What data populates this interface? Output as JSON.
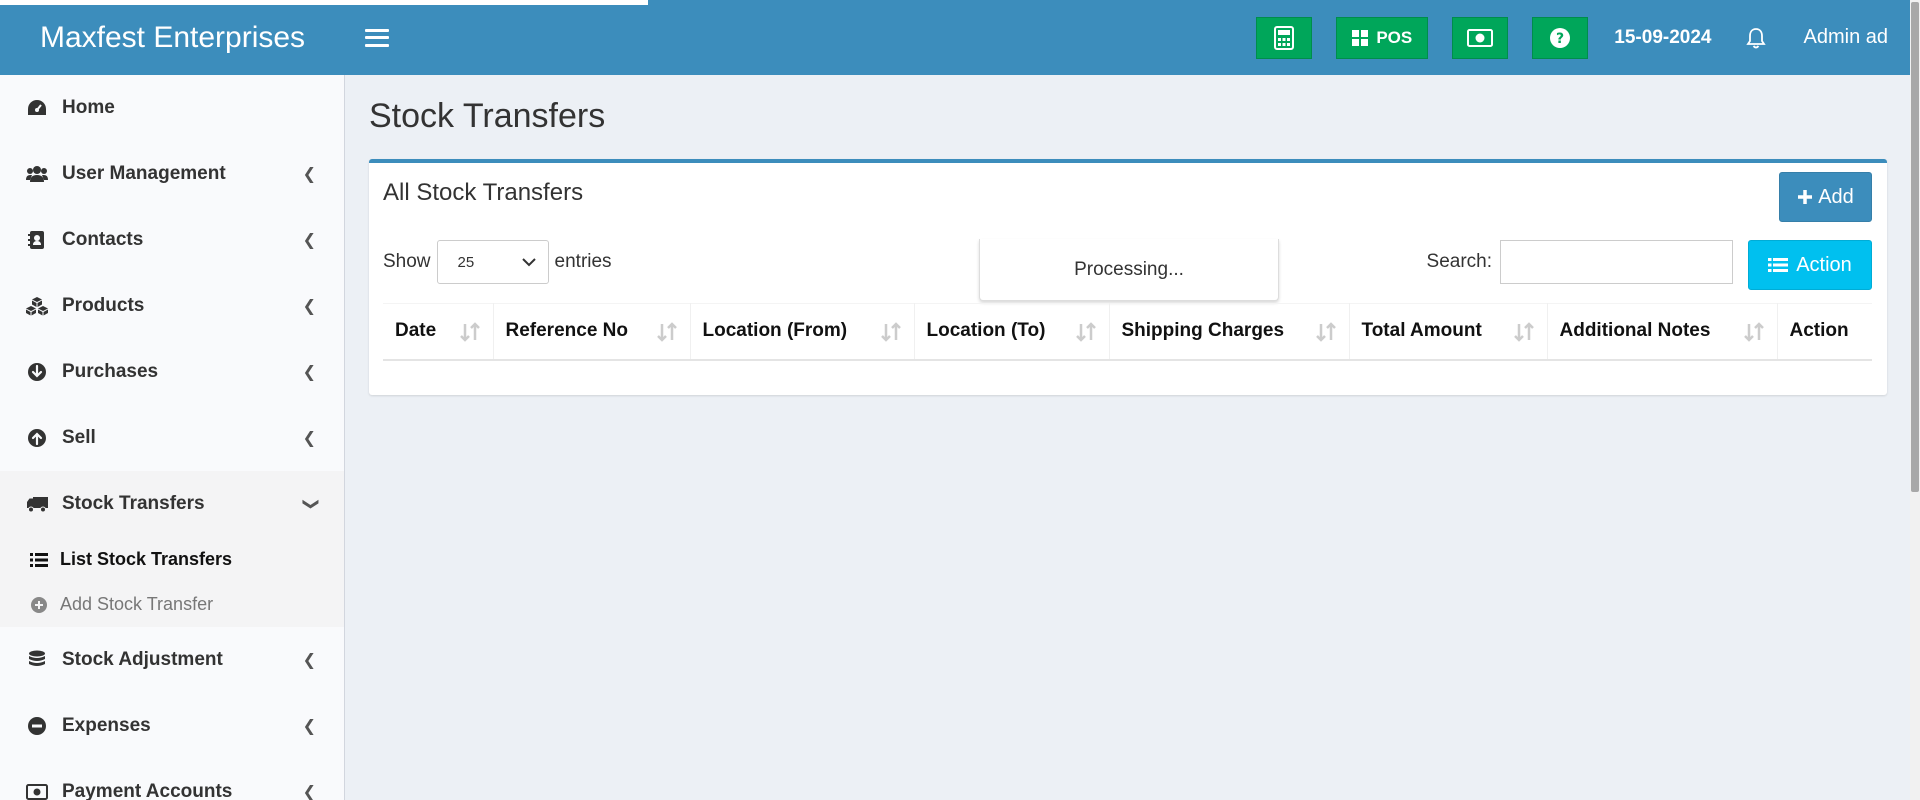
{
  "header": {
    "brand": "Maxfest Enterprises",
    "pos_label": "POS",
    "date": "15-09-2024",
    "user": "Admin ad"
  },
  "colors": {
    "primary": "#3c8dbc",
    "success": "#00a65a",
    "info": "#00c0ef",
    "background": "#ecf0f5"
  },
  "icons": {
    "calculator": "calculator-icon",
    "pos": "grid-icon",
    "cash": "money-icon",
    "help": "question-icon",
    "notifications": "bell-icon",
    "menu": "hamburger-icon"
  },
  "sidebar": {
    "items": [
      {
        "label": "Home",
        "icon": "dashboard-icon"
      },
      {
        "label": "User Management",
        "icon": "users-icon"
      },
      {
        "label": "Contacts",
        "icon": "address-book-icon"
      },
      {
        "label": "Products",
        "icon": "cubes-icon"
      },
      {
        "label": "Purchases",
        "icon": "arrow-circle-down-icon"
      },
      {
        "label": "Sell",
        "icon": "arrow-circle-up-icon"
      },
      {
        "label": "Stock Transfers",
        "icon": "truck-icon"
      },
      {
        "label": "Stock Adjustment",
        "icon": "database-icon"
      },
      {
        "label": "Expenses",
        "icon": "minus-circle-icon"
      },
      {
        "label": "Payment Accounts",
        "icon": "money-icon"
      }
    ],
    "stock_transfer_sub": [
      {
        "label": "List Stock Transfers",
        "icon": "list-icon"
      },
      {
        "label": "Add Stock Transfer",
        "icon": "plus-circle-icon"
      }
    ]
  },
  "main": {
    "page_title": "Stock Transfers",
    "box_title": "All Stock Transfers",
    "add_label": "Add",
    "show_label": "Show",
    "entries_value": "25",
    "entries_label": "entries",
    "processing": "Processing...",
    "search_label": "Search:",
    "search_value": "",
    "action_label": "Action",
    "columns": [
      "Date",
      "Reference No",
      "Location (From)",
      "Location (To)",
      "Shipping Charges",
      "Total Amount",
      "Additional Notes",
      "Action"
    ]
  }
}
